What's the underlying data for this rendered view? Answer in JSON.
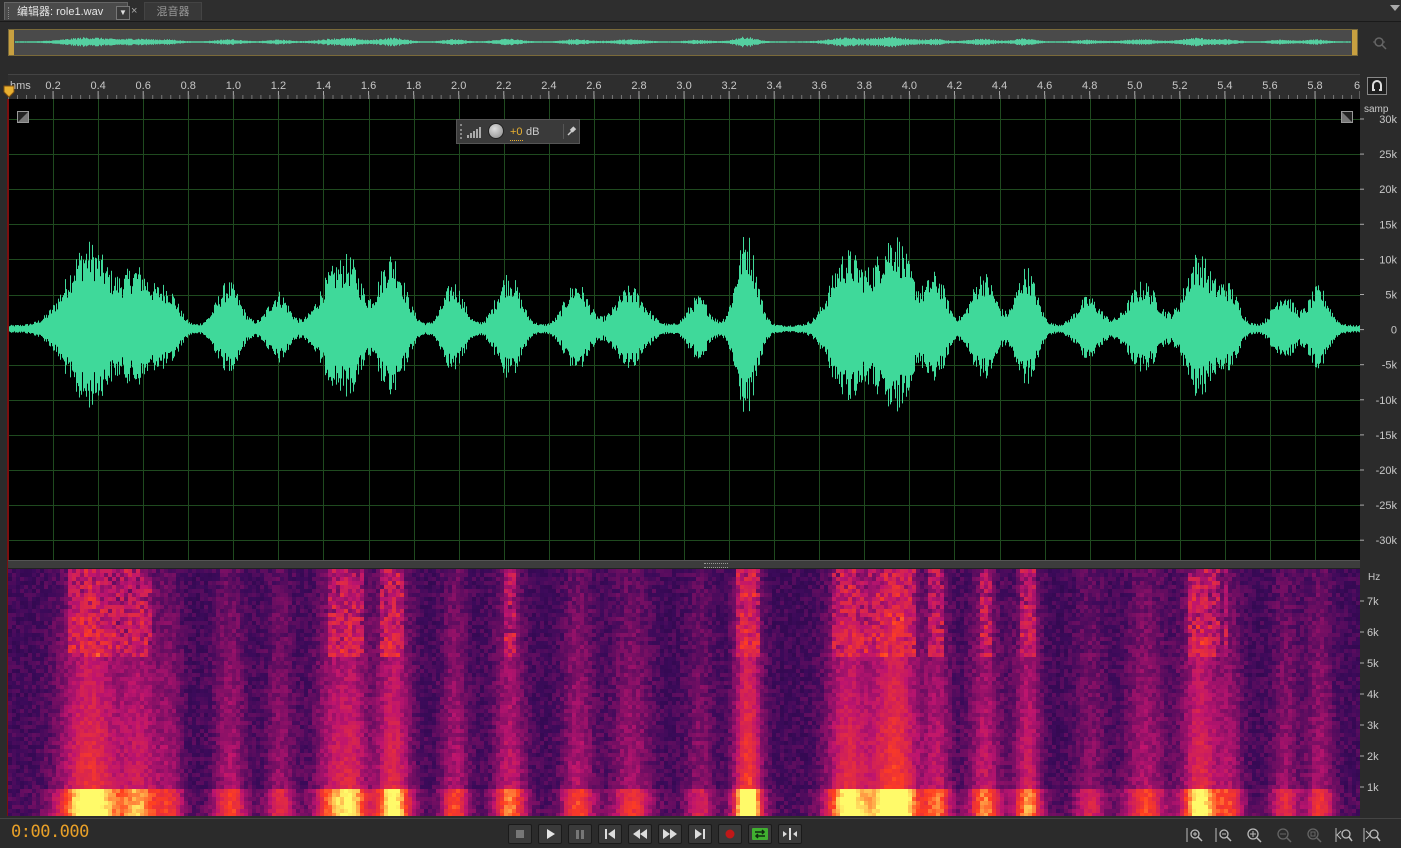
{
  "tabs": {
    "editor_label": "编辑器: role1.wav",
    "close_glyph": "×",
    "mixer_label": "混音器",
    "dropdown_glyph": "▼"
  },
  "ruler": {
    "unit_label": "hms",
    "ticks": [
      "0.2",
      "0.4",
      "0.6",
      "0.8",
      "1.0",
      "1.2",
      "1.4",
      "1.6",
      "1.8",
      "2.0",
      "2.2",
      "2.4",
      "2.6",
      "2.8",
      "3.0",
      "3.2",
      "3.4",
      "3.6",
      "3.8",
      "4.0",
      "4.2",
      "4.4",
      "4.6",
      "4.8",
      "5.0",
      "5.2",
      "5.4",
      "5.6",
      "5.8",
      "6"
    ]
  },
  "amplitude_scale": {
    "unit_label": "samp",
    "ticks": [
      "30k",
      "25k",
      "20k",
      "15k",
      "10k",
      "5k",
      "0",
      "-5k",
      "-10k",
      "-15k",
      "-20k",
      "-25k",
      "-30k"
    ]
  },
  "frequency_scale": {
    "unit_label": "Hz",
    "ticks": [
      "7k",
      "6k",
      "5k",
      "4k",
      "3k",
      "2k",
      "1k"
    ]
  },
  "hud": {
    "gain_value": "+0",
    "gain_unit": "dB"
  },
  "transport": {
    "timecode": "0:00.000",
    "buttons": [
      "stop",
      "play",
      "pause",
      "go-to-start",
      "rewind",
      "fast-forward",
      "go-to-end",
      "record",
      "loop",
      "skip-selection"
    ],
    "zoom_buttons": [
      "zoom-in-amplitude",
      "zoom-out-amplitude",
      "zoom-in-time",
      "zoom-out-time",
      "zoom-out-full",
      "zoom-in-at-start",
      "zoom-in-at-end"
    ]
  },
  "colors": {
    "waveform": "#3fd99a",
    "grid": "#1f4a1f",
    "timecode": "#e8a028",
    "record": "#c01818",
    "loop": "#40b030"
  }
}
